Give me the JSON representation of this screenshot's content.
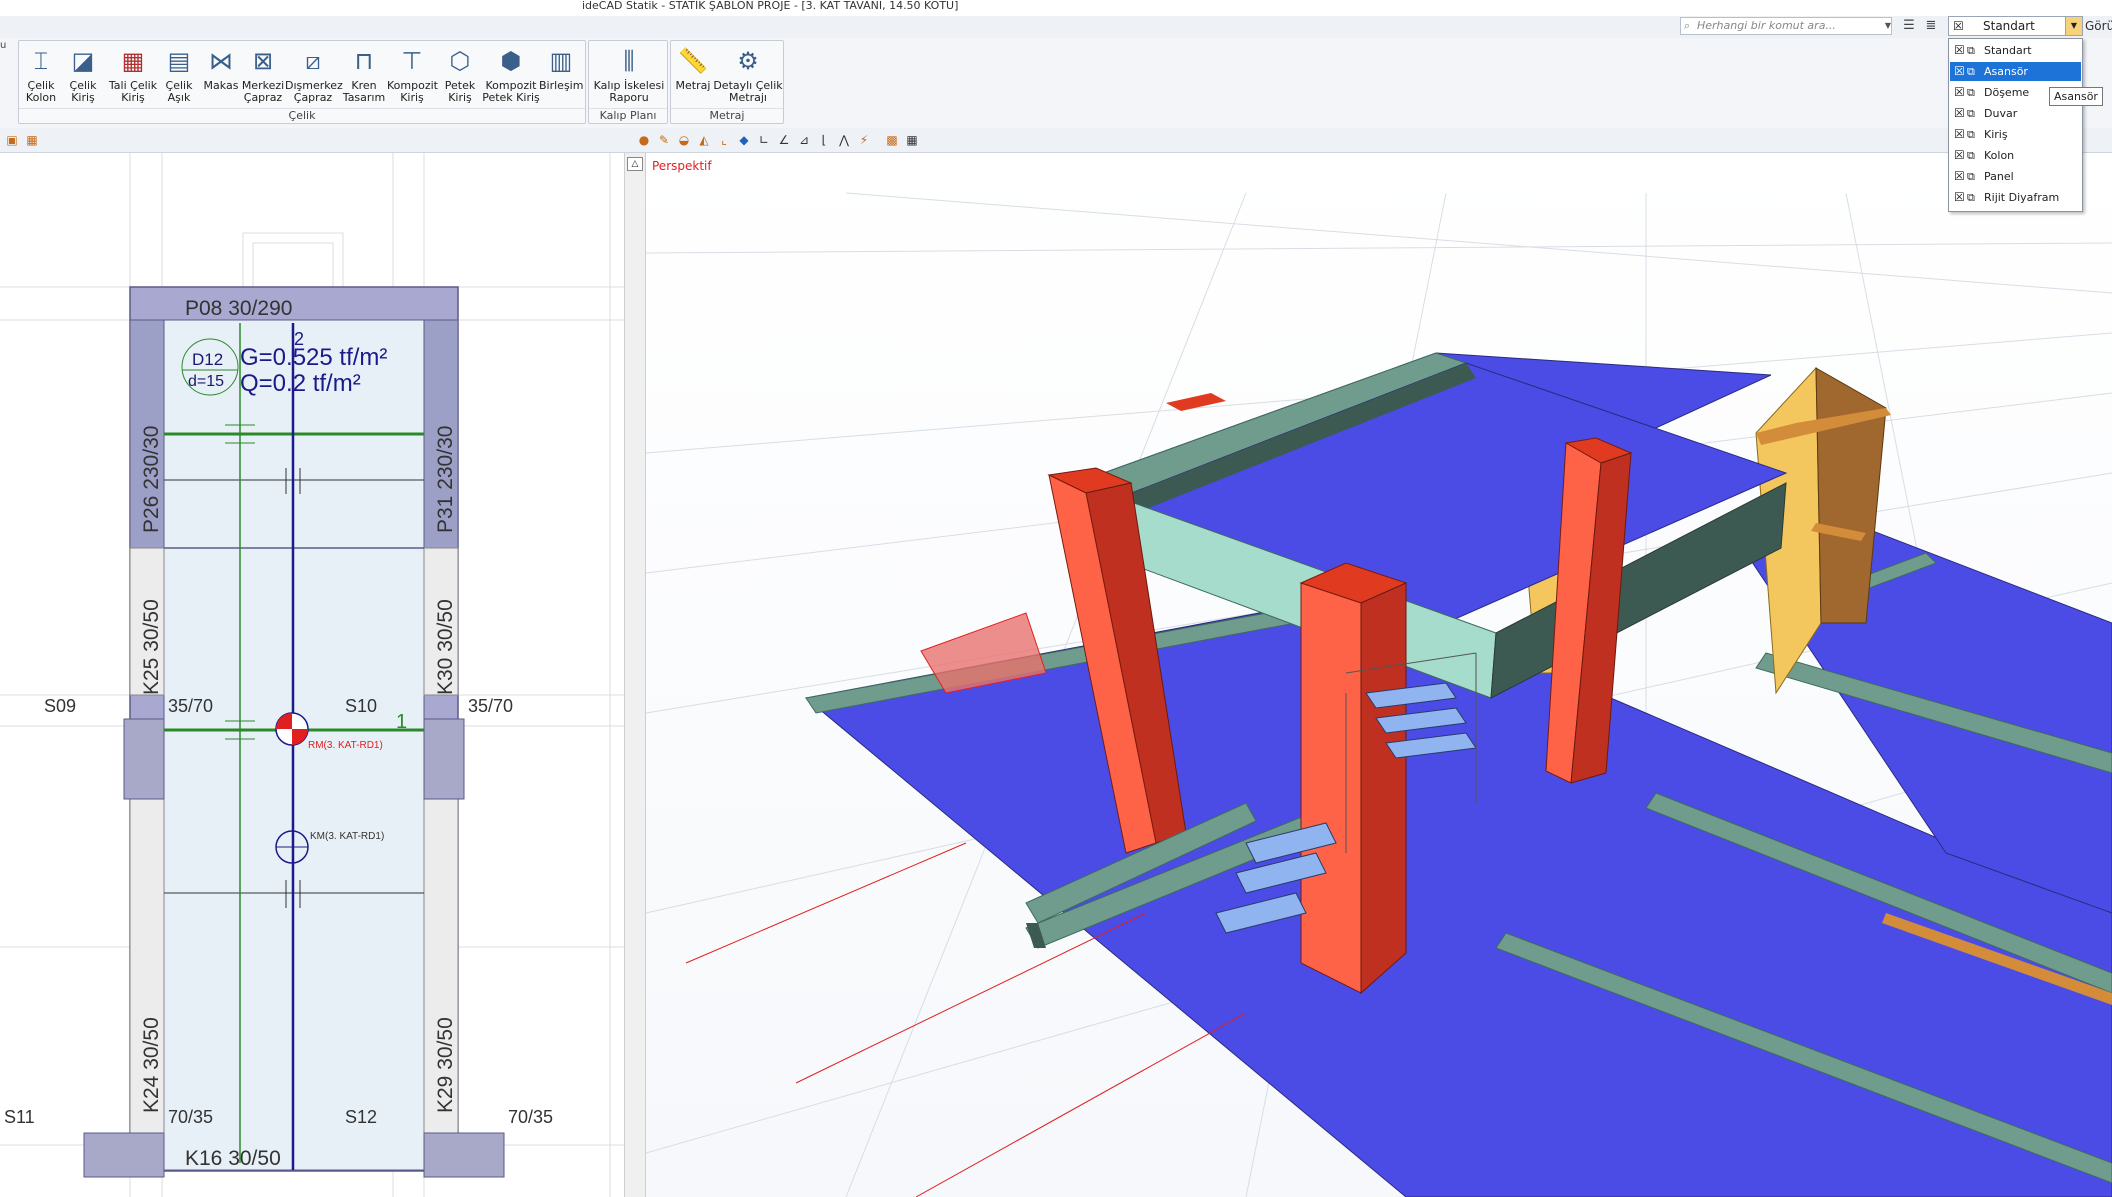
{
  "window": {
    "title": "ideCAD Statik - STATİK ŞABLON PROJE - [3. KAT TAVANI, 14.50 KOTU]"
  },
  "search": {
    "placeholder": "Herhangi bir komut ara..."
  },
  "layer_combo": {
    "value": "Standart",
    "right_label": "Görü"
  },
  "ribbon": {
    "groups": [
      {
        "label": "Çelik",
        "buttons": [
          {
            "line1": "Çelik",
            "line2": "Kolon"
          },
          {
            "line1": "Çelik",
            "line2": "Kiriş"
          },
          {
            "line1": "Tali Çelik",
            "line2": "Kiriş"
          },
          {
            "line1": "Çelik",
            "line2": "Aşık"
          },
          {
            "line1": "Makas",
            "line2": ""
          },
          {
            "line1": "Merkezi",
            "line2": "Çapraz"
          },
          {
            "line1": "Dışmerkez",
            "line2": "Çapraz"
          },
          {
            "line1": "Kren",
            "line2": "Tasarım"
          },
          {
            "line1": "Kompozit",
            "line2": "Kiriş"
          },
          {
            "line1": "Petek",
            "line2": "Kiriş"
          },
          {
            "line1": "Kompozit",
            "line2": "Petek Kiriş"
          },
          {
            "line1": "Birleşim",
            "line2": ""
          }
        ]
      },
      {
        "label": "Kalıp Planı",
        "buttons": [
          {
            "line1": "Kalıp İskelesi",
            "line2": "Raporu"
          }
        ]
      },
      {
        "label": "Metraj",
        "buttons": [
          {
            "line1": "Metraj",
            "line2": ""
          },
          {
            "line1": "Detaylı Çelik",
            "line2": "Metrajı"
          }
        ]
      }
    ]
  },
  "plan": {
    "labels": {
      "p08": "P08 30/290",
      "p26": "P26 230/30",
      "p31": "P31 230/30",
      "k25": "K25 30/50",
      "k30": "K30 30/50",
      "k24": "K24 30/50",
      "k29": "K29 30/50",
      "k16": "K16 30/50",
      "s09": "S09",
      "s10": "S10",
      "s11": "S11",
      "s12": "S12",
      "d35l": "35/70",
      "d35r": "35/70",
      "d70l": "70/35",
      "d70r": "70/35",
      "rebar_d": "D12",
      "rebar_s": "d=15",
      "load_g": "G=0.525 tf/m²",
      "load_q": "Q=0.2 tf/m²",
      "axis2": "2",
      "axis1": "1",
      "rm": "RM(3. KAT-RD1)",
      "km": "KM(3. KAT-RD1)"
    }
  },
  "view3d": {
    "label": "Perspektif"
  },
  "dropdown": {
    "items": [
      {
        "label": "Standart",
        "selected": false
      },
      {
        "label": "Asansör",
        "selected": true
      },
      {
        "label": "Döşeme",
        "selected": false
      },
      {
        "label": "Duvar",
        "selected": false
      },
      {
        "label": "Kiriş",
        "selected": false
      },
      {
        "label": "Kolon",
        "selected": false
      },
      {
        "label": "Panel",
        "selected": false
      },
      {
        "label": "Rijit Diyafram",
        "selected": false
      }
    ]
  },
  "tooltip": {
    "text": "Asansör"
  },
  "colors": {
    "slab": "#4b4be6",
    "column": "#ff6347",
    "beam": "#6f9c8c",
    "wall": "#f3c65e",
    "accent": "#1e73d8"
  }
}
